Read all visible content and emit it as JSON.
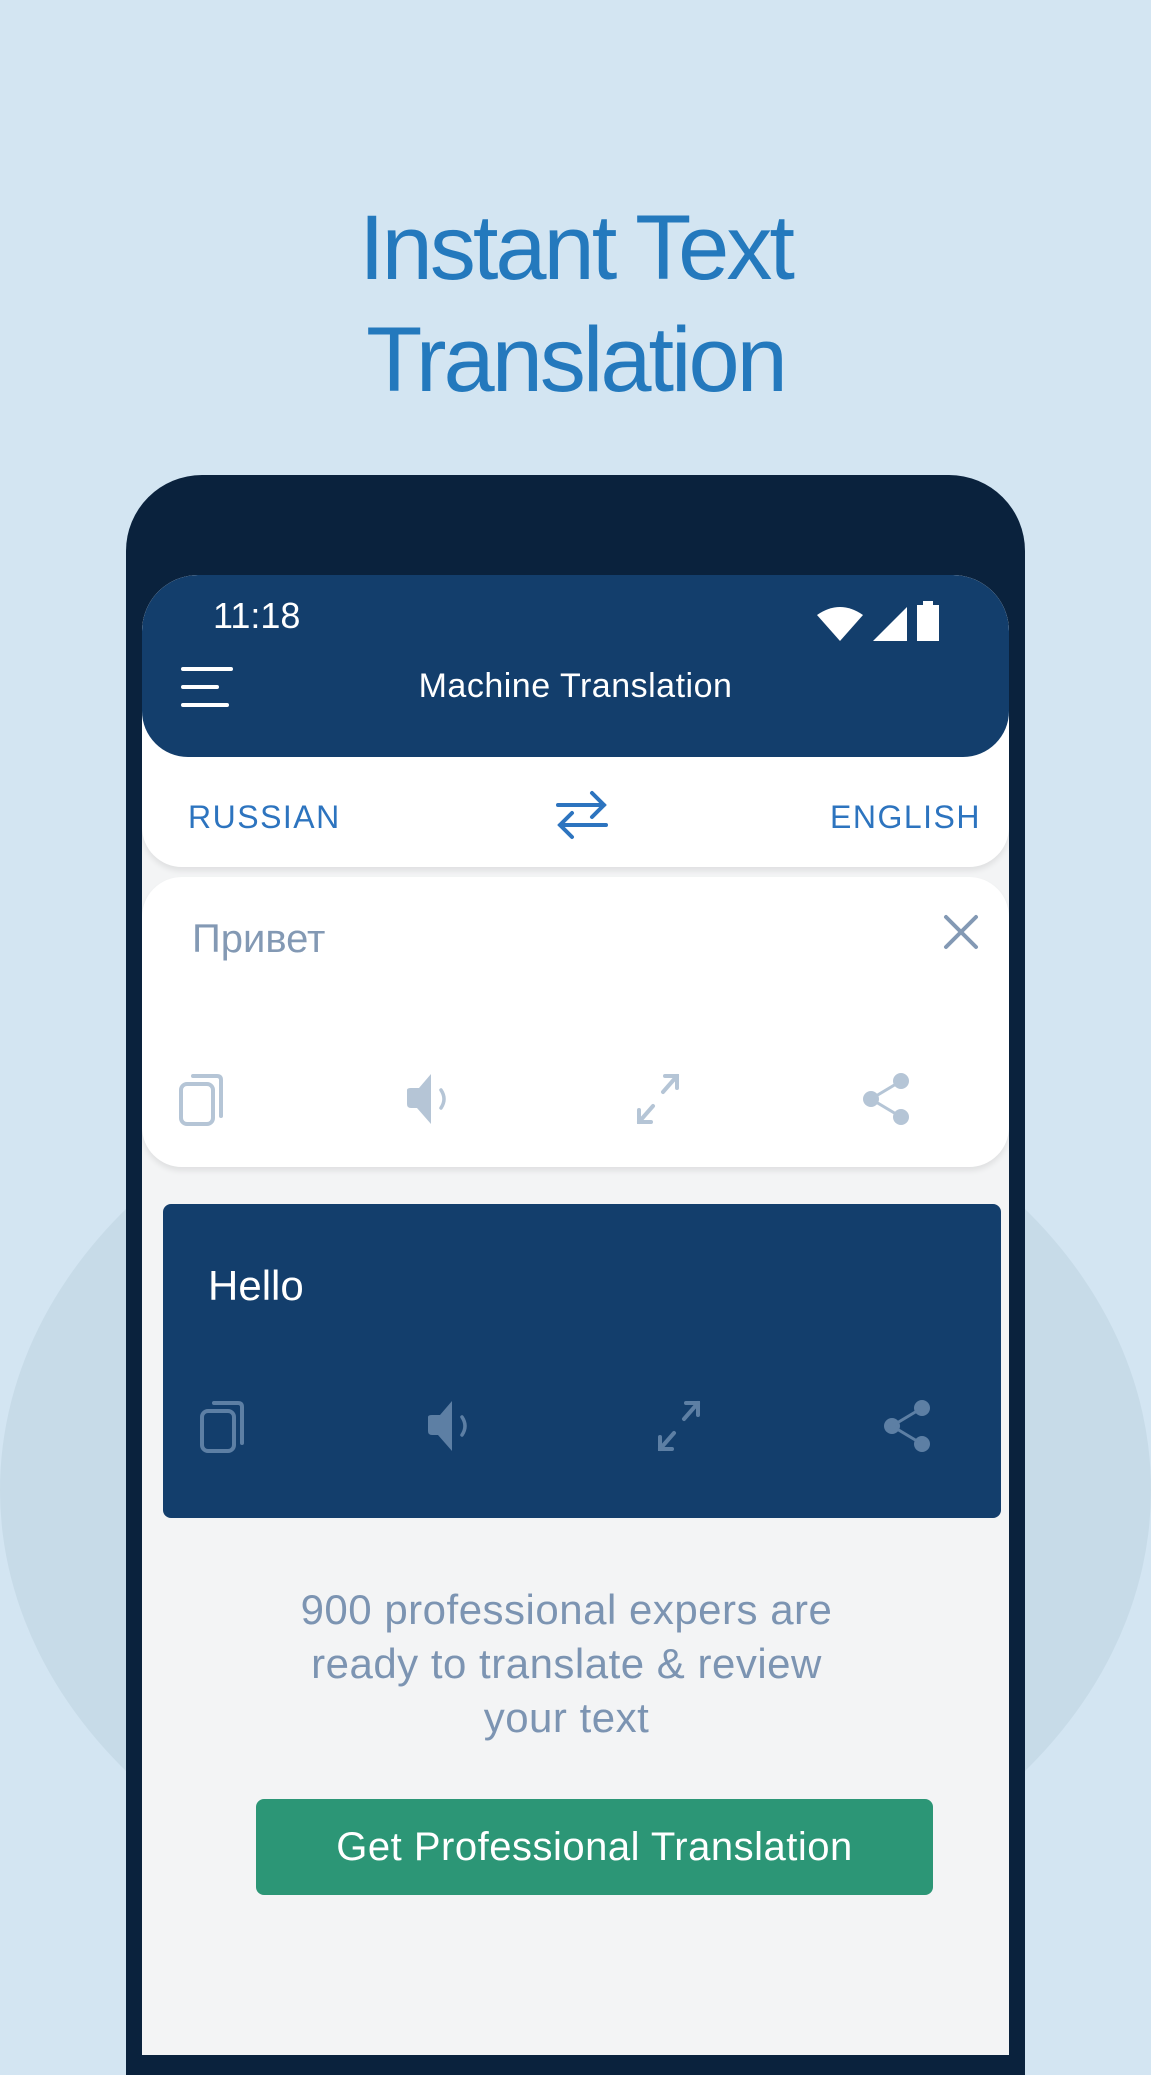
{
  "headline": {
    "line1": "Instant Text",
    "line2": "Translation"
  },
  "status_bar": {
    "time": "11:18",
    "icons": [
      "wifi-icon",
      "signal-icon",
      "battery-icon"
    ]
  },
  "app_bar": {
    "menu_icon": "hamburger-menu-icon",
    "title": "Machine Translation"
  },
  "languages": {
    "source": "RUSSIAN",
    "target": "ENGLISH",
    "swap_icon": "swap-arrows-icon"
  },
  "input": {
    "text": "Привет",
    "clear_icon": "close-icon",
    "actions": [
      "copy-icon",
      "speaker-icon",
      "expand-icon",
      "share-icon"
    ]
  },
  "output": {
    "text": "Hello",
    "actions": [
      "copy-icon",
      "speaker-icon",
      "expand-icon",
      "share-icon"
    ]
  },
  "promo": {
    "line1": "900 professional expers are",
    "line2": "ready to translate & review",
    "line3": "your text"
  },
  "cta": {
    "label": "Get Professional Translation"
  },
  "colors": {
    "background": "#d3e5f2",
    "headline": "#2479bd",
    "phone_frame": "#0a223d",
    "app_bar": "#133e6c",
    "language_label": "#2d74bf",
    "muted_text": "#8399b4",
    "cta": "#2c9676"
  }
}
